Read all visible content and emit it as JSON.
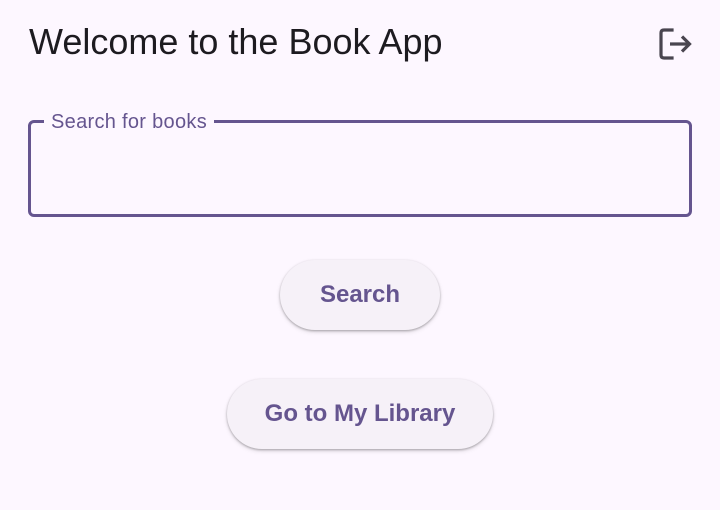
{
  "app_bar": {
    "title": "Welcome to the Book App",
    "logout_icon": "logout-icon"
  },
  "search": {
    "label": "Search for books",
    "value": "",
    "placeholder": ""
  },
  "buttons": {
    "search_label": "Search",
    "library_label": "Go to My Library"
  },
  "colors": {
    "background": "#fdf7ff",
    "primary": "#65558f",
    "on_surface": "#1d1b20",
    "button_surface": "#f6f1f8"
  }
}
